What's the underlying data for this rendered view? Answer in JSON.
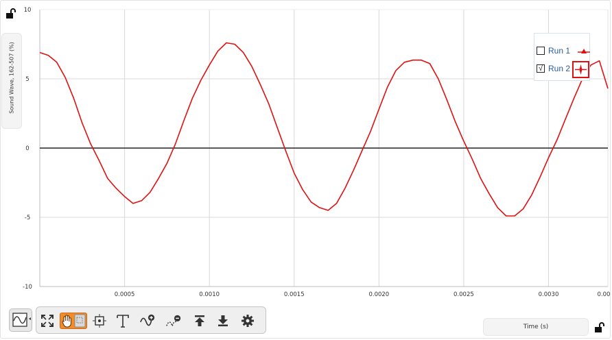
{
  "y_axis": {
    "label": "Sound Wave, 162-507 (%)"
  },
  "x_axis": {
    "label": "Time (s)"
  },
  "legend": {
    "items": [
      {
        "label": "Run 1",
        "checked": false,
        "checkbox_text": ""
      },
      {
        "label": "Run 2",
        "checked": true,
        "checkbox_text": "√"
      }
    ]
  },
  "colors": {
    "series": "#e01010",
    "zero_line": "#222222",
    "grid": "#d8d8d8",
    "legend_text": "#2a5b9a",
    "select_highlight": "#f28c28"
  },
  "toolbar": {
    "buttons": [
      "graph-type",
      "autoscale",
      "pan",
      "zoom-box",
      "examine",
      "annotate",
      "curve-fit",
      "remove-fit",
      "move-up",
      "move-down",
      "settings"
    ]
  },
  "chart_data": {
    "type": "line",
    "xlabel": "Time (s)",
    "ylabel": "Sound Wave, 162-507 (%)",
    "xlim": [
      0.0,
      0.00335
    ],
    "ylim": [
      -10,
      10
    ],
    "x_ticks": [
      "0.0005",
      "0.0010",
      "0.0015",
      "0.0020",
      "0.0025",
      "0.0030",
      "0.00"
    ],
    "y_ticks": [
      "10",
      "5",
      "0",
      "-5",
      "-10"
    ],
    "grid": true,
    "legend_position": "top-right",
    "series": [
      {
        "name": "Run 2",
        "color": "#e01010",
        "x": [
          0.0,
          5e-05,
          0.0001,
          0.00015,
          0.0002,
          0.00025,
          0.0003,
          0.00035,
          0.0004,
          0.00045,
          0.0005,
          0.00055,
          0.0006,
          0.00065,
          0.0007,
          0.00075,
          0.0008,
          0.00085,
          0.0009,
          0.00095,
          0.001,
          0.00105,
          0.0011,
          0.00115,
          0.0012,
          0.00125,
          0.0013,
          0.00135,
          0.0014,
          0.00145,
          0.0015,
          0.00155,
          0.0016,
          0.00165,
          0.0017,
          0.00175,
          0.0018,
          0.00185,
          0.0019,
          0.00195,
          0.002,
          0.00205,
          0.0021,
          0.00215,
          0.0022,
          0.00225,
          0.0023,
          0.00235,
          0.0024,
          0.00245,
          0.0025,
          0.00255,
          0.0026,
          0.00265,
          0.0027,
          0.00275,
          0.0028,
          0.00285,
          0.0029,
          0.00295,
          0.003,
          0.00305,
          0.0031,
          0.00315,
          0.0032,
          0.00325,
          0.0033,
          0.00335
        ],
        "values": [
          6.9,
          6.7,
          6.2,
          5.1,
          3.6,
          1.8,
          0.3,
          -0.9,
          -2.2,
          -2.9,
          -3.5,
          -4.0,
          -3.8,
          -3.2,
          -2.2,
          -1.1,
          0.3,
          2.0,
          3.6,
          4.9,
          6.0,
          7.0,
          7.6,
          7.5,
          6.9,
          5.9,
          4.6,
          3.2,
          1.5,
          -0.2,
          -1.8,
          -3.0,
          -3.9,
          -4.3,
          -4.5,
          -4.0,
          -2.9,
          -1.6,
          -0.2,
          1.2,
          2.8,
          4.4,
          5.6,
          6.2,
          6.35,
          6.35,
          6.1,
          5.0,
          3.5,
          1.9,
          0.5,
          -0.8,
          -2.2,
          -3.3,
          -4.3,
          -4.9,
          -4.9,
          -4.4,
          -3.4,
          -2.1,
          -0.7,
          0.6,
          2.1,
          3.6,
          5.0,
          6.0,
          6.3,
          4.3
        ]
      }
    ]
  }
}
